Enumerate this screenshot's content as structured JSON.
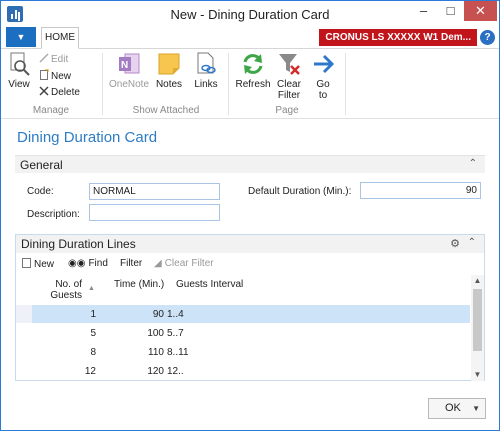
{
  "window": {
    "title": "New - Dining Duration Card"
  },
  "tabs": {
    "home": "HOME"
  },
  "company": "CRONUS LS XXXXX W1 Dem...",
  "ribbon": {
    "manage": {
      "label": "Manage",
      "view": "View",
      "edit": "Edit",
      "new": "New",
      "delete": "Delete"
    },
    "show_attached": {
      "label": "Show Attached",
      "onenote": "OneNote",
      "notes": "Notes",
      "links": "Links"
    },
    "page": {
      "label": "Page",
      "refresh": "Refresh",
      "clear_filter": "Clear Filter",
      "go_to": "Go to"
    }
  },
  "page_title": "Dining Duration Card",
  "general": {
    "title": "General",
    "code_label": "Code:",
    "code_value": "NORMAL",
    "description_label": "Description:",
    "description_value": "",
    "default_duration_label": "Default Duration (Min.):",
    "default_duration_value": "90"
  },
  "lines": {
    "title": "Dining Duration Lines",
    "toolbar": {
      "new": "New",
      "find": "Find",
      "filter": "Filter",
      "clear_filter": "Clear Filter"
    },
    "columns": {
      "no_of_guests": "No. of Guests",
      "time": "Time (Min.)",
      "guests_interval": "Guests Interval"
    },
    "rows": [
      {
        "guests": "1",
        "time": "90",
        "interval": "1..4"
      },
      {
        "guests": "5",
        "time": "100",
        "interval": "5..7"
      },
      {
        "guests": "8",
        "time": "110",
        "interval": "8..11"
      },
      {
        "guests": "12",
        "time": "120",
        "interval": "12.."
      }
    ]
  },
  "ok_button": "OK"
}
